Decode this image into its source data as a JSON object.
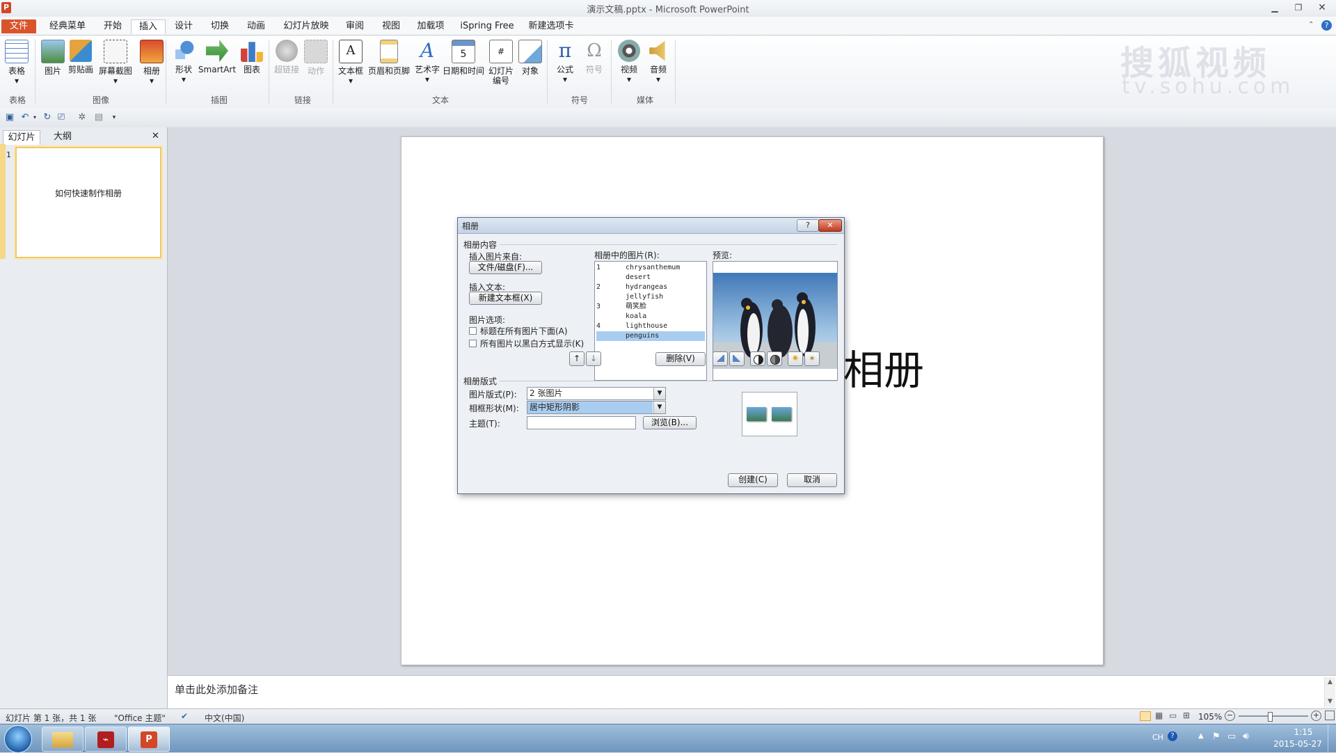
{
  "window": {
    "title": "演示文稿.pptx - Microsoft PowerPoint"
  },
  "tabs": [
    "文件",
    "经典菜单",
    "开始",
    "插入",
    "设计",
    "切换",
    "动画",
    "幻灯片放映",
    "审阅",
    "视图",
    "加载项",
    "iSpring Free",
    "新建选项卡"
  ],
  "ribbon": {
    "buttons": [
      "表格",
      "图片",
      "剪贴画",
      "屏幕截图",
      "相册",
      "形状",
      "SmartArt",
      "图表",
      "超链接",
      "动作",
      "文本框",
      "页眉和页脚",
      "艺术字",
      "日期和时间",
      "幻灯片编号",
      "对象",
      "公式",
      "符号",
      "视频",
      "音频"
    ],
    "groups": [
      "表格",
      "图像",
      "插图",
      "链接",
      "文本",
      "符号",
      "媒体"
    ]
  },
  "watermark": {
    "line1": "搜狐视频",
    "line2": "tv.sohu.com"
  },
  "left_pane": {
    "tab_slides": "幻灯片",
    "tab_outline": "大纲",
    "close": "✕",
    "slide_number": "1",
    "thumb_title": "如何快速制作相册"
  },
  "slide": {
    "title_visible": "相册"
  },
  "notes": {
    "placeholder": "单击此处添加备注"
  },
  "dialog": {
    "title": "相册",
    "help": "?",
    "close": "✕",
    "section_content": "相册内容",
    "insert_from": "插入图片来自:",
    "file_disk_button": "文件/磁盘(F)...",
    "insert_text": "插入文本:",
    "new_textbox_button": "新建文本框(X)",
    "picture_options": "图片选项:",
    "opt_caption": "标题在所有图片下面(A)",
    "opt_bw": "所有图片以黑白方式显示(K)",
    "pictures_label": "相册中的图片(R):",
    "pictures": [
      {
        "num": "1",
        "name": "chrysanthemum"
      },
      {
        "num": "",
        "name": "desert"
      },
      {
        "num": "2",
        "name": "hydrangeas"
      },
      {
        "num": "",
        "name": "jellyfish"
      },
      {
        "num": "3",
        "name": "萌笑脸"
      },
      {
        "num": "",
        "name": "koala"
      },
      {
        "num": "4",
        "name": "lighthouse"
      },
      {
        "num": "",
        "name": "penguins"
      }
    ],
    "selected_picture": "penguins",
    "preview_label": "预览:",
    "up_icon": "up-arrow-icon",
    "down_icon": "down-arrow-icon",
    "delete_button": "删除(V)",
    "section_layout": "相册版式",
    "layout_label": "图片版式(P):",
    "layout_value": "2 张图片",
    "frame_label": "相框形状(M):",
    "frame_value": "居中矩形阴影",
    "theme_label": "主题(T):",
    "theme_value": "",
    "browse_button": "浏览(B)...",
    "create_button": "创建(C)",
    "cancel_button": "取消"
  },
  "statusbar": {
    "slide_info": "幻灯片 第 1 张，共 1 张",
    "theme": "\"Office 主题\"",
    "language": "中文(中国)",
    "zoom": "105%"
  },
  "taskbar": {
    "lang": "CH",
    "time": "1:15",
    "date": "2015-05-27"
  },
  "colors": {
    "file_tab": "#d9532b",
    "selection": "#a9cdf0",
    "taskbar": "#7fa3c8"
  }
}
